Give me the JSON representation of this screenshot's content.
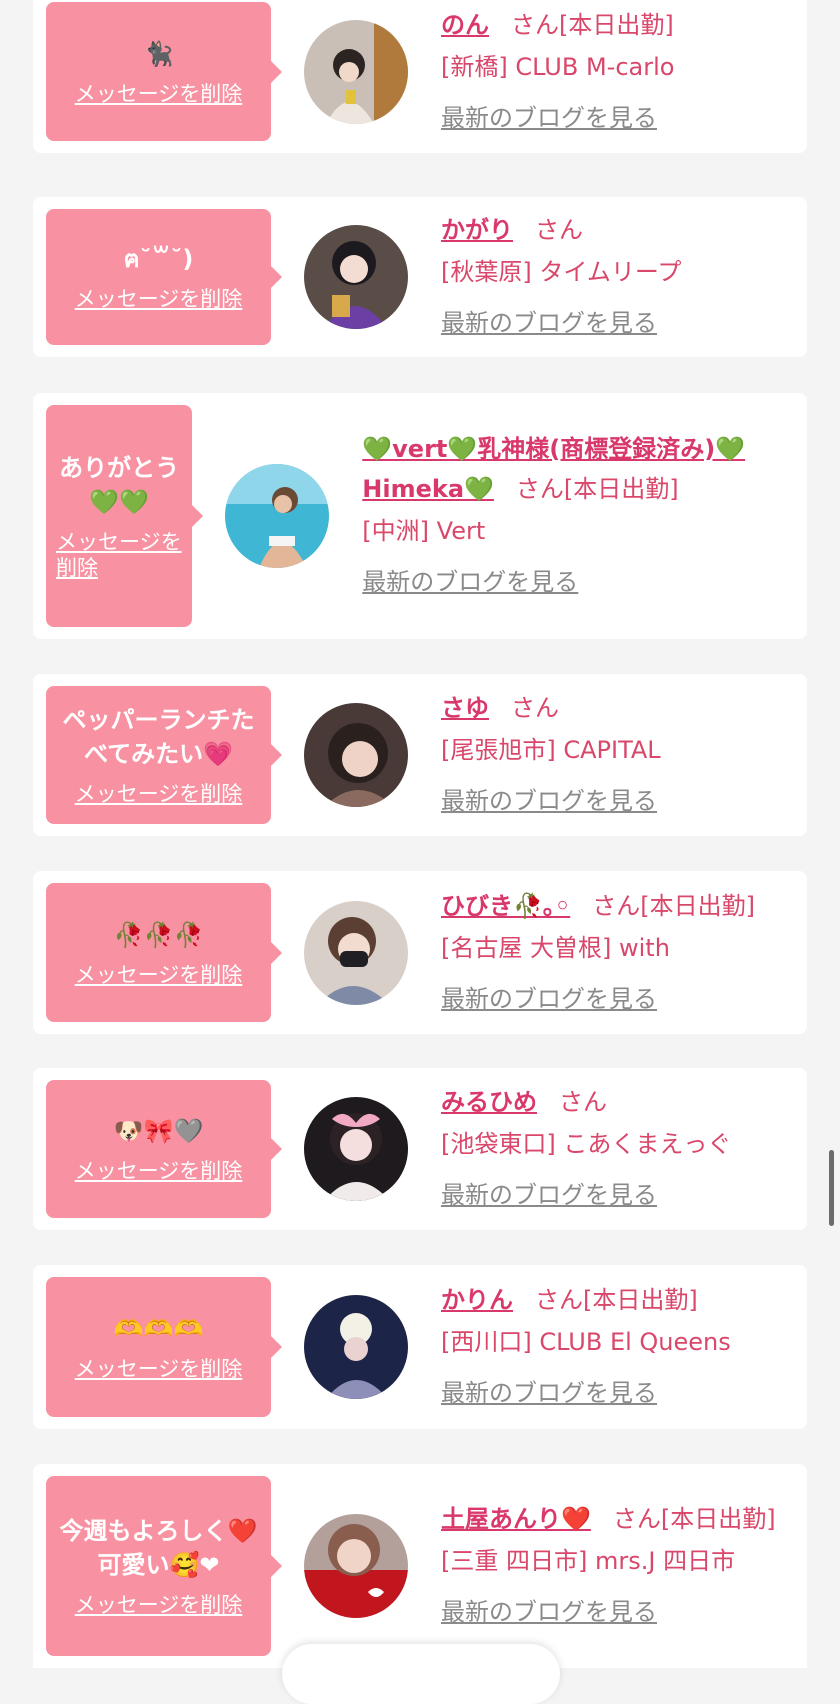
{
  "delete_label": "メッセージを削除",
  "blog_label": "最新のブログを見る",
  "cards": [
    {
      "message": "🐈‍⬛",
      "name": "のん",
      "suffix": "さん[本日出勤]",
      "shop": "[新橋] CLUB M-carlo"
    },
    {
      "message": "ฅ˘꒳˘)",
      "name": "かがり",
      "suffix": "さん",
      "shop": "[秋葉原] タイムリープ"
    },
    {
      "message": "ありがとう💚💚",
      "name": "💚vert💚乳神様(商標登録済み)💚Himeka💚",
      "suffix": "さん[本日出勤]",
      "shop": "[中洲] Vert"
    },
    {
      "message": "ペッパーランチたべてみたい💗",
      "name": "さゆ",
      "suffix": "さん",
      "shop": "[尾張旭市] CAPITAL"
    },
    {
      "message": "🥀🥀🥀",
      "name": "ひびき🥀｡◦",
      "suffix": "さん[本日出勤]",
      "shop": "[名古屋 大曽根] with"
    },
    {
      "message": "🐶🎀🩶",
      "name": "みるひめ",
      "suffix": "さん",
      "shop": "[池袋東口] こあくまえっぐ"
    },
    {
      "message": "🫶🫶🫶",
      "name": "かりん",
      "suffix": "さん[本日出勤]",
      "shop": "[西川口] CLUB El Queens"
    },
    {
      "message": "今週もよろしく❤️可愛い🥰❤",
      "name": "土屋あんり❤️",
      "suffix": "さん[本日出勤]",
      "shop": "[三重 四日市] mrs.J 四日市"
    }
  ]
}
